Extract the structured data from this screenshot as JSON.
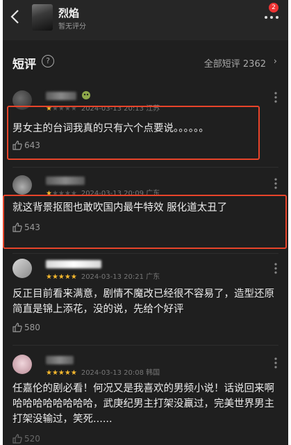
{
  "header": {
    "title": "烈焰",
    "subtitle": "暂无评分",
    "badge": "2"
  },
  "section": {
    "title": "短评",
    "help": "?",
    "all_reviews_label": "全部短评 2362",
    "arrow": "›"
  },
  "reviews": [
    {
      "rating_stars": 1,
      "date": "2024-03-13 20:13",
      "location": "江苏",
      "text": "男女主的台词我真的只有六个点要说。。。。。。",
      "likes": "643"
    },
    {
      "rating_stars": 1,
      "date": "2024-03-13 20:09",
      "location": "广东",
      "text": "就这背景抠图也敢吹国内最牛特效 服化道太丑了",
      "likes": "543"
    },
    {
      "rating_stars": 5,
      "date": "2024-03-13 20:21",
      "location": "广东",
      "text": "反正目前看来满意，剧情不魔改已经很不容易了，造型还原简直是锦上添花，没的说，先给个好评",
      "likes": "580"
    },
    {
      "rating_stars": 5,
      "date": "2024-03-13 20:08",
      "location": "韩国",
      "text": "任嘉伦的剧必看！何况又是我喜欢的男频小说！话说回来啊哈哈哈哈哈哈哈哈，武庚纪男主打架没赢过，完美世界男主打架没输过，笑死......",
      "likes": "520"
    }
  ],
  "colors": {
    "background": "#1f1f1f",
    "header": "#262626",
    "star": "#f5b82e",
    "highlight": "#e8442a"
  }
}
